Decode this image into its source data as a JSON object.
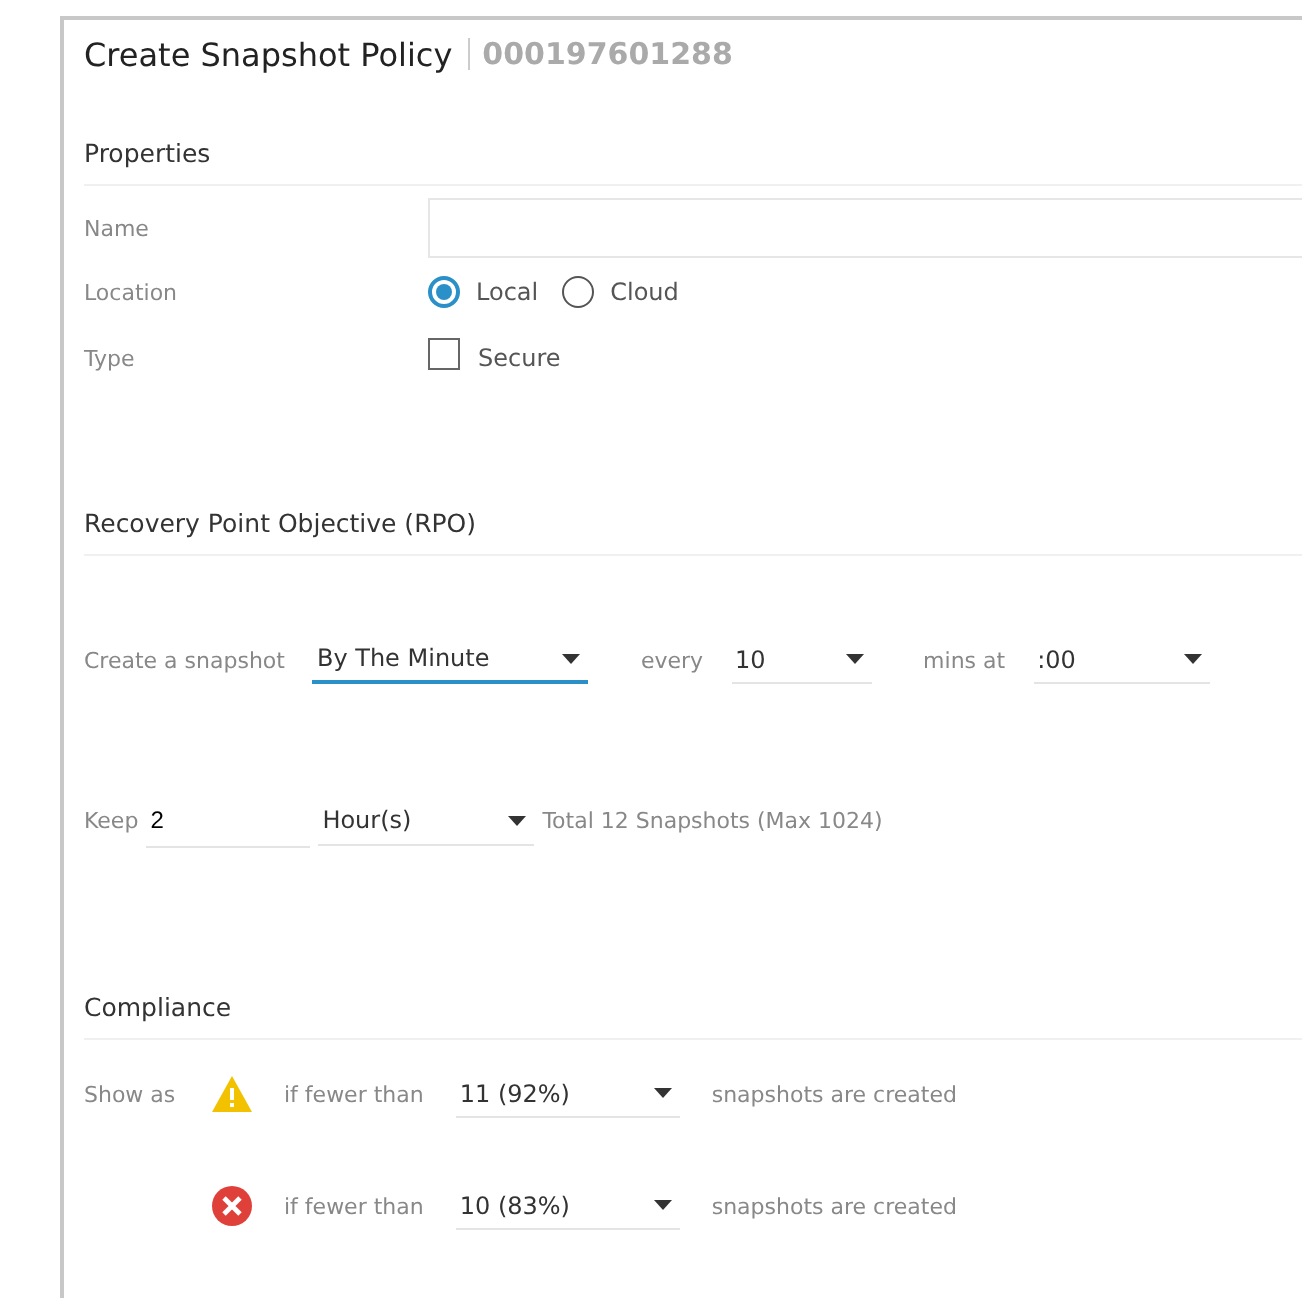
{
  "dialog": {
    "title": "Create Snapshot Policy",
    "subtitle": "000197601288"
  },
  "properties": {
    "heading": "Properties",
    "name": {
      "label": "Name"
    },
    "location": {
      "label": "Location",
      "options": [
        {
          "label": "Local",
          "selected": true
        },
        {
          "label": "Cloud",
          "selected": false
        }
      ]
    },
    "type": {
      "label": "Type",
      "checkbox": {
        "label": "Secure",
        "checked": false
      }
    }
  },
  "rpo": {
    "heading": "Recovery Point Objective (RPO)",
    "create": {
      "label": "Create a snapshot",
      "frequency": {
        "value": "By The Minute",
        "focused": true
      },
      "every_label": "every",
      "interval": {
        "value": "10",
        "focused": false
      },
      "mins_label": "mins at",
      "offset": {
        "value": ":00",
        "focused": false
      }
    },
    "keep": {
      "label": "Keep",
      "count": "2",
      "unit": {
        "value": "Hour(s)",
        "focused": false
      },
      "total": "Total 12 Snapshots (Max 1024)"
    }
  },
  "compliance": {
    "heading": "Compliance",
    "rows": [
      {
        "label": "Show as",
        "kind": "warning",
        "condition": "if fewer than",
        "threshold": "11 (92%)",
        "suffix": "snapshots are created"
      },
      {
        "kind": "error",
        "condition": "if fewer than",
        "threshold": "10 (83%)",
        "suffix": "snapshots are created"
      }
    ]
  }
}
